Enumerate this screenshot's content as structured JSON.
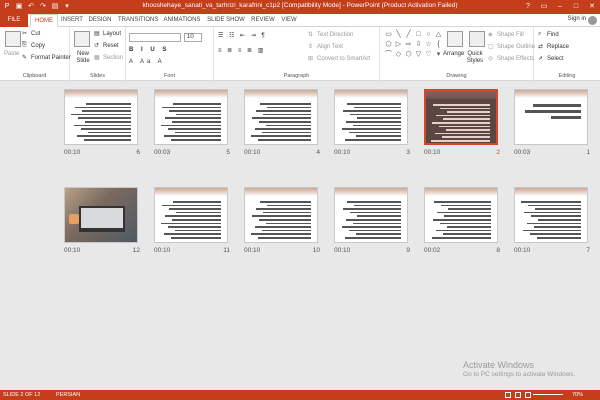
{
  "window": {
    "title": "khooshehaye_sanati_va_tarhrizi_karafrini_c1p2 [Compatibility Mode] - PowerPoint (Product Activation Failed)",
    "signin": "Sign in"
  },
  "tabs": [
    {
      "label": "FILE"
    },
    {
      "label": "HOME"
    },
    {
      "label": "INSERT"
    },
    {
      "label": "DESIGN"
    },
    {
      "label": "TRANSITIONS"
    },
    {
      "label": "ANIMATIONS"
    },
    {
      "label": "SLIDE SHOW"
    },
    {
      "label": "REVIEW"
    },
    {
      "label": "VIEW"
    }
  ],
  "ribbon": {
    "clipboard": {
      "paste": "Paste",
      "cut": "Cut",
      "copy": "Copy",
      "format_painter": "Format Painter",
      "label": "Clipboard"
    },
    "slides": {
      "new_slide": "New Slide",
      "layout": "Layout",
      "reset": "Reset",
      "section": "Section",
      "label": "Slides"
    },
    "font": {
      "size": "10",
      "label": "Font"
    },
    "paragraph": {
      "text_direction": "Text Direction",
      "align_text": "Align Text",
      "smartart": "Convert to SmartArt",
      "label": "Paragraph"
    },
    "drawing": {
      "arrange": "Arrange",
      "quick_styles": "Quick Styles",
      "shape_fill": "Shape Fill",
      "shape_outline": "Shape Outline",
      "shape_effects": "Shape Effects",
      "label": "Drawing"
    },
    "editing": {
      "find": "Find",
      "replace": "Replace",
      "select": "Select",
      "label": "Editing"
    }
  },
  "slides": [
    {
      "number": "1",
      "time": "00:03"
    },
    {
      "number": "2",
      "time": "00:10"
    },
    {
      "number": "3",
      "time": "00:10"
    },
    {
      "number": "4",
      "time": "00:10"
    },
    {
      "number": "5",
      "time": "00:03"
    },
    {
      "number": "6",
      "time": "00:10"
    },
    {
      "number": "7",
      "time": "00:10"
    },
    {
      "number": "8",
      "time": "00:02"
    },
    {
      "number": "9",
      "time": "00:10"
    },
    {
      "number": "10",
      "time": "00:10"
    },
    {
      "number": "11",
      "time": "00:10"
    },
    {
      "number": "12",
      "time": "00:10"
    }
  ],
  "watermark": {
    "line1": "Activate Windows",
    "line2": "Go to PC settings to activate Windows."
  },
  "status": {
    "slide_of": "SLIDE 2 OF 12",
    "language": "PERSIAN",
    "zoom": "70%"
  },
  "colors": {
    "accent": "#c43e1c",
    "selected_border": "#d24726"
  }
}
